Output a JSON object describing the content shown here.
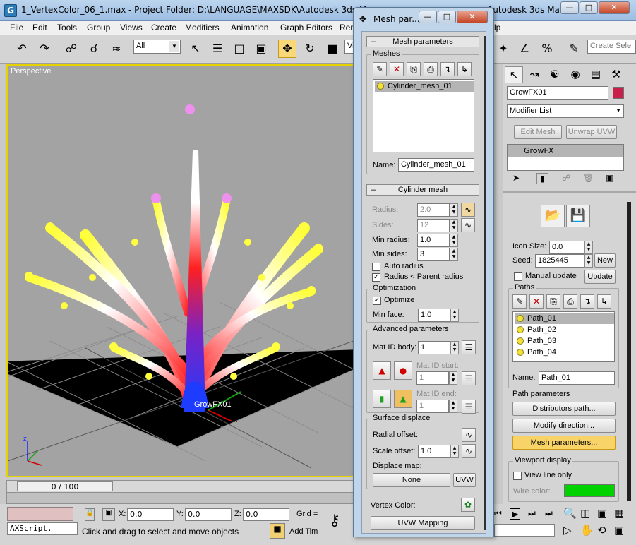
{
  "window": {
    "title_left": "1_VertexColor_06_1.max",
    "title_project": "- Project Folder: D:\\LANGUAGE\\MAXSDK\\Autodesk 3ds Max",
    "title_right": "Autodesk 3ds Ma...",
    "app_icon": "G"
  },
  "menu": [
    "File",
    "Edit",
    "Tools",
    "Group",
    "Views",
    "Create",
    "Modifiers",
    "Animation",
    "Graph Editors",
    "Ren",
    "lp"
  ],
  "toolbar": {
    "selection_filter": "All",
    "viewcube_combo": "Vi",
    "create_selection_set": "Create Sele"
  },
  "viewport": {
    "label": "Perspective",
    "object_label": "GrowFX01",
    "axis_x": "x",
    "axis_y": "y",
    "axis_z": "z"
  },
  "timeslider": {
    "position": "0 / 100"
  },
  "status": {
    "maxscript": "AXScript.",
    "prompt": "Click and drag to select and move objects",
    "x_label": "X:",
    "x": "0.0",
    "y_label": "Y:",
    "y": "0.0",
    "z_label": "Z:",
    "z": "0.0",
    "grid": "Grid =",
    "add_time_tag": "Add Tim"
  },
  "command_panel": {
    "object_name": "GrowFX01",
    "object_color": "#c8204a",
    "modifier_list": "Modifier List",
    "edit_mesh": "Edit Mesh",
    "unwrap_uvw": "Unwrap UVW",
    "stack_item": "GrowFX",
    "icon_size_label": "Icon Size:",
    "icon_size": "0.0",
    "seed_label": "Seed:",
    "seed": "1825445",
    "new_button": "New",
    "manual_update": "Manual update",
    "update_button": "Update",
    "paths_group": "Paths",
    "paths": [
      "Path_01",
      "Path_02",
      "Path_03",
      "Path_04"
    ],
    "name_label": "Name:",
    "path_name": "Path_01",
    "path_parameters": "Path parameters",
    "distributors_path": "Distributors path...",
    "modify_direction": "Modify direction...",
    "mesh_parameters": "Mesh parameters...",
    "viewport_display": "Viewport display",
    "view_line_only": "View line only",
    "wire_color_label": "Wire color:",
    "wire_color": "#00d200"
  },
  "dialog": {
    "title": "Mesh par...",
    "mesh_parameters_header": "Mesh parameters",
    "meshes_group": "Meshes",
    "mesh_item": "Cylinder_mesh_01",
    "name_label": "Name:",
    "mesh_name": "Cylinder_mesh_01",
    "cylinder_header": "Cylinder mesh",
    "radius_label": "Radius:",
    "radius": "2.0",
    "sides_label": "Sides:",
    "sides": "12",
    "min_radius_label": "Min radius:",
    "min_radius": "1.0",
    "min_sides_label": "Min sides:",
    "min_sides": "3",
    "auto_radius": "Auto radius",
    "radius_parent": "Radius < Parent radius",
    "optimization_group": "Optimization",
    "optimize": "Optimize",
    "min_face_label": "Min face:",
    "min_face": "1.0",
    "advanced_group": "Advanced parameters",
    "mat_id_body_label": "Mat ID body:",
    "mat_id_body": "1",
    "mat_id_start_label": "Mat ID start:",
    "mat_id_start": "1",
    "mat_id_end_label": "Mat ID end:",
    "mat_id_end": "1",
    "surface_group": "Surface displace",
    "radial_offset_label": "Radial offset:",
    "scale_offset_label": "Scale offset:",
    "scale_offset": "1.0",
    "displace_map_label": "Displace map:",
    "none_button": "None",
    "uvw_button": "UVW",
    "vertex_color_label": "Vertex Color:",
    "uvw_mapping_button": "UVW Mapping"
  }
}
